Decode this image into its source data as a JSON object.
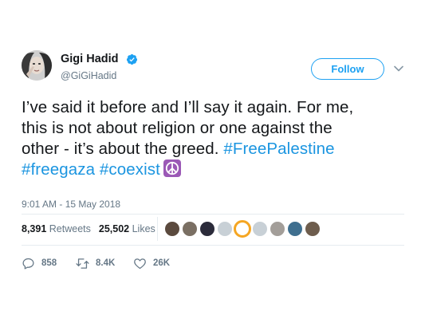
{
  "user": {
    "name": "Gigi Hadid",
    "handle": "@GiGiHadid",
    "verified": true
  },
  "follow_label": "Follow",
  "tweet": {
    "lines": [
      "I’ve said it before and I’ll say it again. For me,",
      "this is not about religion or one against the",
      "other - it’s about the greed. "
    ],
    "hashtag_freepalestine": "#FreePalestine",
    "hashtag_freegaza": "#freegaza",
    "hashtag_coexist": "#coexist",
    "emoji": "peace-symbol-icon"
  },
  "timestamp": "9:01 AM - 15 May 2018",
  "stats": {
    "retweets_count": "8,391",
    "retweets_label": "Retweets",
    "likes_count": "25,502",
    "likes_label": "Likes"
  },
  "actions": {
    "reply_count": "858",
    "retweet_count": "8.4K",
    "like_count": "26K"
  },
  "colors": {
    "accent": "#1da1f2",
    "hashtag": "#1b95e0",
    "muted": "#657786",
    "text": "#14171a",
    "divider": "#e6ecf0",
    "emoji_purple": "#9b59b6"
  }
}
